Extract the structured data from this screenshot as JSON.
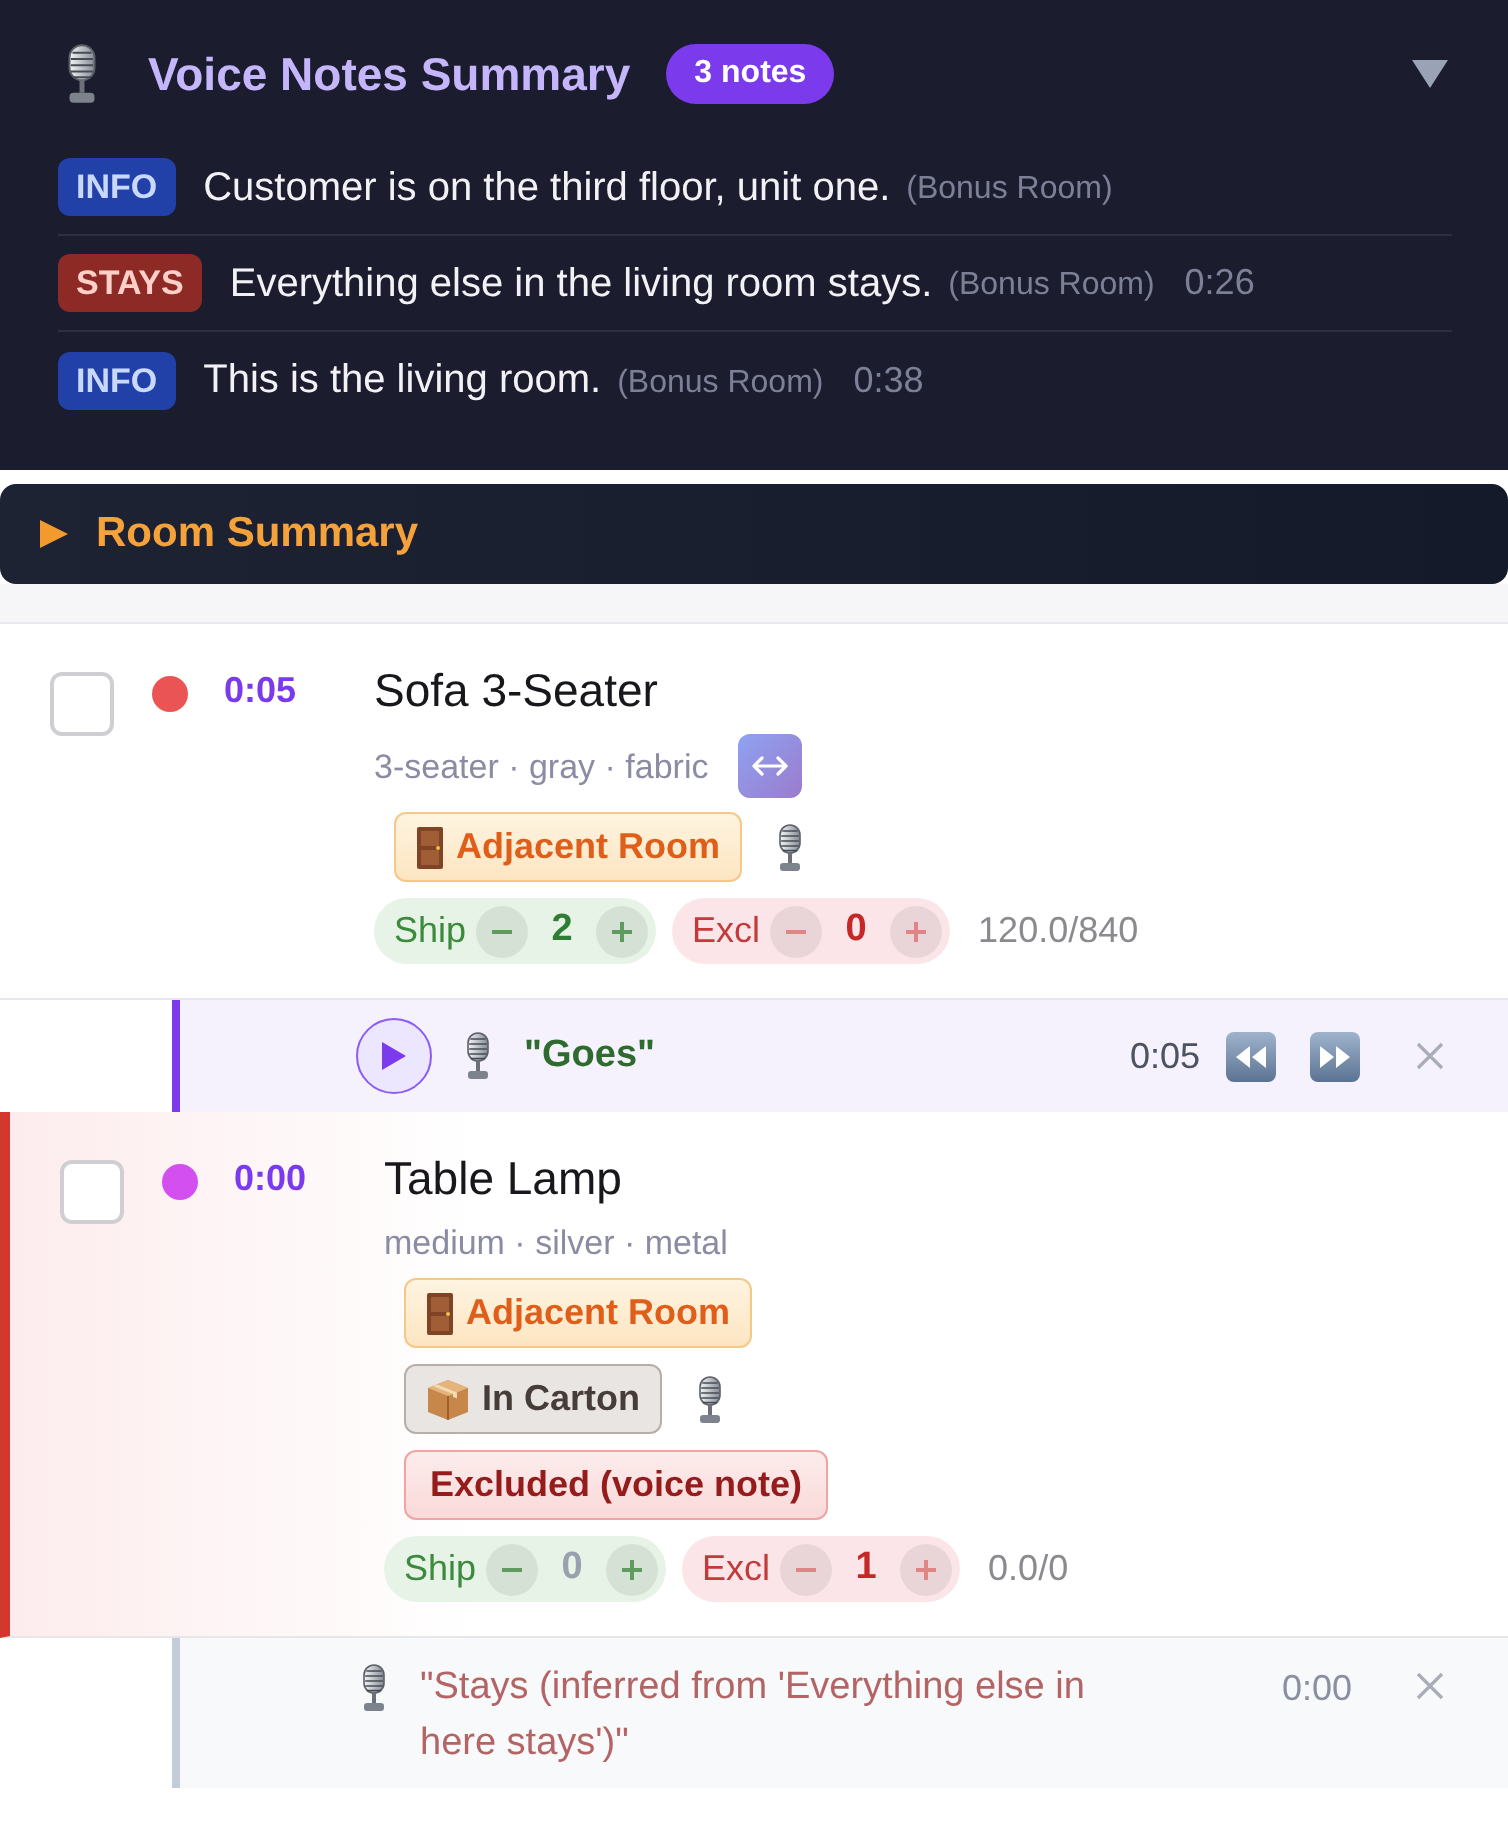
{
  "voice_notes_summary": {
    "title": "Voice Notes Summary",
    "count_badge": "3 notes",
    "expanded": true,
    "notes": [
      {
        "kind": "info",
        "badge": "INFO",
        "text": "Customer is on the third floor, unit one.",
        "location": "(Bonus Room)"
      },
      {
        "kind": "stays",
        "badge": "STAYS",
        "text": "Everything else in the living room stays.",
        "location": "(Bonus Room)",
        "time": "0:26"
      },
      {
        "kind": "info",
        "badge": "INFO",
        "text": "This is the living room.",
        "location": "(Bonus Room)",
        "time": "0:38"
      }
    ]
  },
  "room_summary": {
    "title": "Room Summary",
    "expanded": false
  },
  "items": [
    {
      "checked": false,
      "color": "#ea5455",
      "time": "0:05",
      "name": "Sofa 3-Seater",
      "details": "3-seater · gray · fabric",
      "size_button": true,
      "excluded": false,
      "tags": [
        {
          "kind": "room",
          "label": "Adjacent Room",
          "voice": true
        }
      ],
      "ship": {
        "label": "Ship",
        "count": "2"
      },
      "excl": {
        "label": "Excl",
        "count": "0"
      },
      "volume": "120.0/840",
      "voice_note": {
        "active": true,
        "kind": "goes",
        "quote": "\"Goes\"",
        "time": "0:05"
      }
    },
    {
      "checked": false,
      "color": "#d34ff0",
      "time": "0:00",
      "name": "Table Lamp",
      "details": "medium · silver · metal",
      "size_button": false,
      "excluded": true,
      "tags": [
        {
          "kind": "room",
          "label": "Adjacent Room",
          "voice": false
        },
        {
          "kind": "carton",
          "label": "In Carton",
          "voice": true
        },
        {
          "kind": "excluded",
          "label": "Excluded (voice note)",
          "voice": false
        }
      ],
      "ship": {
        "label": "Ship",
        "count": "0"
      },
      "excl": {
        "label": "Excl",
        "count": "1"
      },
      "volume": "0.0/0",
      "voice_note": {
        "active": false,
        "kind": "stays",
        "quote": "\"Stays (inferred from 'Everything else in here stays')\"",
        "time": "0:00"
      }
    }
  ]
}
